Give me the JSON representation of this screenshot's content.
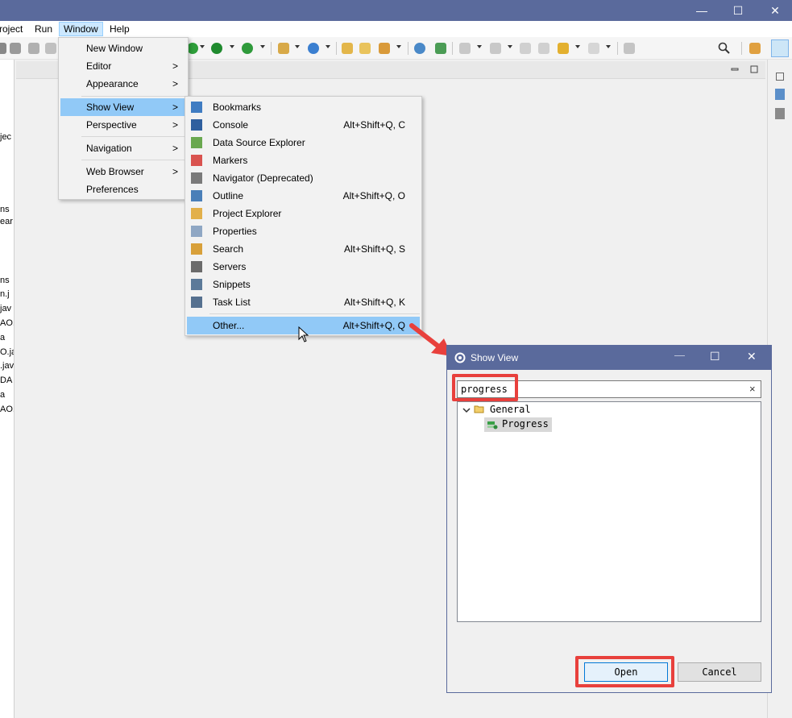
{
  "menubar": {
    "items": [
      "roject",
      "Run",
      "Window",
      "Help"
    ]
  },
  "window_menu": {
    "items": [
      {
        "label": "New Window",
        "submenu": false
      },
      {
        "label": "Editor",
        "submenu": true
      },
      {
        "label": "Appearance",
        "submenu": true
      },
      {
        "label": "Show View",
        "submenu": true
      },
      {
        "label": "Perspective",
        "submenu": true
      },
      {
        "label": "Navigation",
        "submenu": true
      },
      {
        "label": "Web Browser",
        "submenu": true
      },
      {
        "label": "Preferences",
        "submenu": false
      }
    ],
    "submenu_arrow": ">"
  },
  "show_view_menu": {
    "items": [
      {
        "label": "Bookmarks",
        "shortcut": "",
        "icon": "bookmarks-icon"
      },
      {
        "label": "Console",
        "shortcut": "Alt+Shift+Q, C",
        "icon": "console-icon"
      },
      {
        "label": "Data Source Explorer",
        "shortcut": "",
        "icon": "data-source-explorer-icon"
      },
      {
        "label": "Markers",
        "shortcut": "",
        "icon": "markers-icon"
      },
      {
        "label": "Navigator (Deprecated)",
        "shortcut": "",
        "icon": "navigator-icon"
      },
      {
        "label": "Outline",
        "shortcut": "Alt+Shift+Q, O",
        "icon": "outline-icon"
      },
      {
        "label": "Project Explorer",
        "shortcut": "",
        "icon": "project-explorer-icon"
      },
      {
        "label": "Properties",
        "shortcut": "",
        "icon": "properties-icon"
      },
      {
        "label": "Search",
        "shortcut": "Alt+Shift+Q, S",
        "icon": "search-icon"
      },
      {
        "label": "Servers",
        "shortcut": "",
        "icon": "servers-icon"
      },
      {
        "label": "Snippets",
        "shortcut": "",
        "icon": "snippets-icon"
      },
      {
        "label": "Task List",
        "shortcut": "Alt+Shift+Q, K",
        "icon": "task-list-icon"
      }
    ],
    "other": {
      "label": "Other...",
      "shortcut": "Alt+Shift+Q, Q"
    }
  },
  "left_panel_fragments": [
    "jec",
    "ns",
    "ear",
    "ns",
    "n.j",
    "jav",
    "AO.",
    "a",
    "O.ja",
    ".jav",
    "DA",
    "a",
    "AO."
  ],
  "dialog": {
    "title": "Show View",
    "filter_value": "progress",
    "clear_symbol": "×",
    "tree": {
      "category": "General",
      "item": "Progress"
    },
    "open_label": "Open",
    "cancel_label": "Cancel"
  },
  "colors": {
    "title_bar": "#5a6a9c",
    "menu_highlight": "#91c9f7",
    "annotation_red": "#e8403c"
  }
}
